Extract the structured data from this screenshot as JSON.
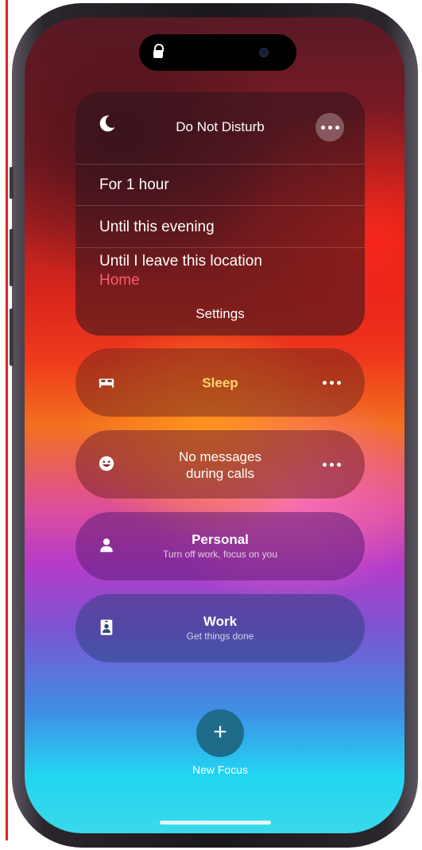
{
  "focus_menu": {
    "dnd": {
      "title": "Do Not Disturb",
      "icon": "moon-icon",
      "options": [
        "For 1 hour",
        "Until this evening",
        "Until I leave this location"
      ],
      "location_label": "Home",
      "settings_label": "Settings"
    },
    "modes": [
      {
        "title": "Sleep",
        "subtitle": "",
        "icon": "bed-icon"
      },
      {
        "title_line1": "No messages",
        "title_line2": "during calls",
        "icon": "smiley-icon"
      },
      {
        "title": "Personal",
        "subtitle": "Turn off work, focus on you",
        "icon": "person-icon"
      },
      {
        "title": "Work",
        "subtitle": "Get things done",
        "icon": "id-badge-icon"
      }
    ],
    "new_focus_label": "New Focus",
    "new_focus_icon": "plus-icon"
  },
  "colors": {
    "accent_location": "#ff5b6e",
    "new_focus_button": "#1f6c8a"
  }
}
